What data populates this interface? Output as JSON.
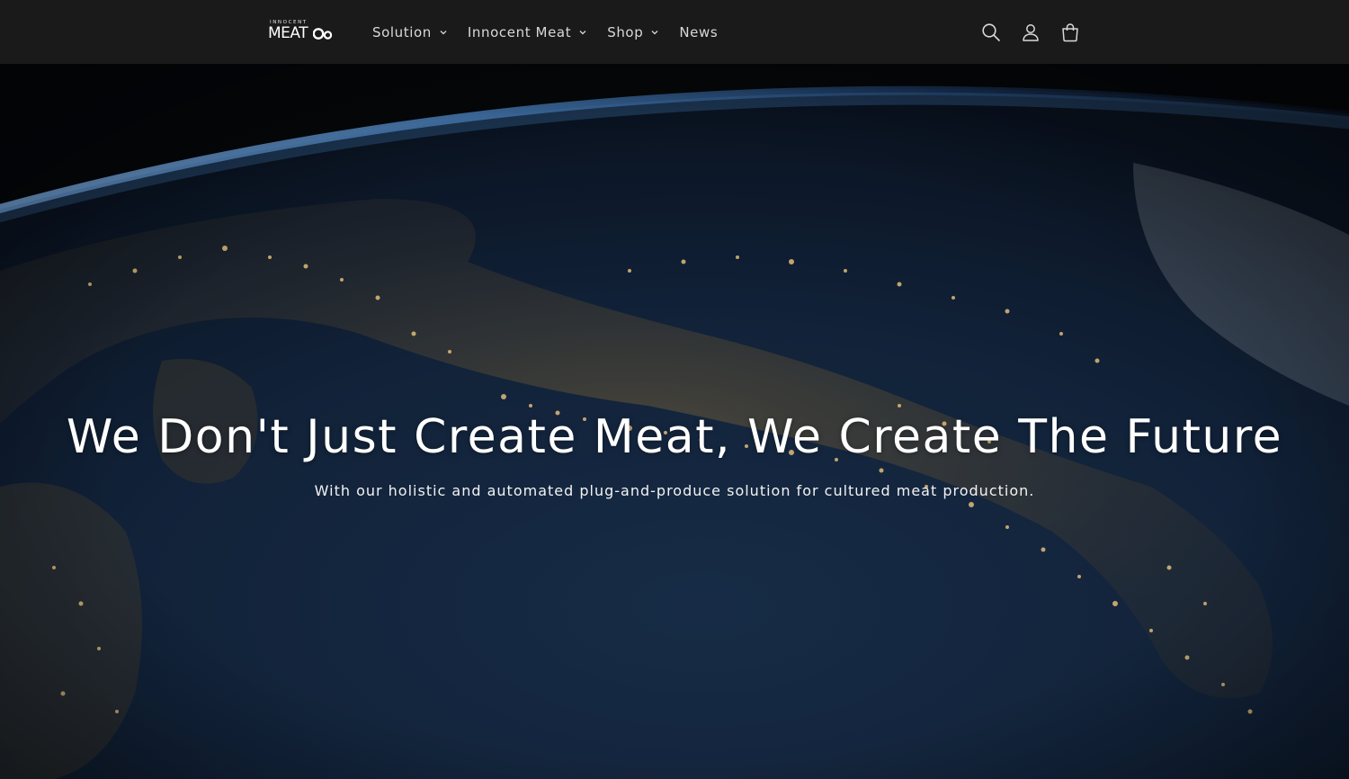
{
  "header": {
    "logo": {
      "small_text": "INNOCENT",
      "big_text": "MEAT"
    },
    "nav": [
      {
        "label": "Solution",
        "has_dropdown": true
      },
      {
        "label": "Innocent Meat",
        "has_dropdown": true
      },
      {
        "label": "Shop",
        "has_dropdown": true
      },
      {
        "label": "News",
        "has_dropdown": false
      }
    ],
    "icons": [
      "search-icon",
      "account-icon",
      "cart-icon"
    ]
  },
  "hero": {
    "title": "We Don't Just Create Meat, We Create The Future",
    "subtitle": "With our holistic and automated plug-and-produce solution for cultured meat production.",
    "background": "night-earth-from-space"
  },
  "colors": {
    "header_bg": "#1a1a1a",
    "text": "#ffffff",
    "nav_text": "#d9d9d9"
  }
}
